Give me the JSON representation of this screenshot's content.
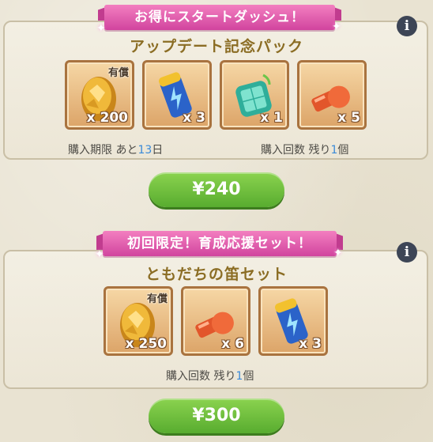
{
  "pack1": {
    "ribbon": "お得にスタートダッシュ！",
    "title": "アップデート記念パック",
    "items": [
      {
        "icon": "gem-icon",
        "qty": "x 200",
        "badge": "有償"
      },
      {
        "icon": "battery-icon",
        "qty": "x 3"
      },
      {
        "icon": "radar-device-icon",
        "qty": "x 1"
      },
      {
        "icon": "whistle-icon",
        "qty": "x 5"
      }
    ],
    "deadline_prefix": "購入期限 あと",
    "deadline_num": "13",
    "deadline_suffix": "日",
    "remaining_prefix": "購入回数 残り",
    "remaining_num": "1",
    "remaining_suffix": "個",
    "price": "¥240"
  },
  "pack2": {
    "ribbon": "初回限定！育成応援セット！",
    "title": "ともだちの笛セット",
    "items": [
      {
        "icon": "gem-icon",
        "qty": "x 250",
        "badge": "有償"
      },
      {
        "icon": "whistle-icon",
        "qty": "x 6"
      },
      {
        "icon": "battery-icon",
        "qty": "x 3"
      }
    ],
    "remaining_prefix": "購入回数 残り",
    "remaining_num": "1",
    "remaining_suffix": "個",
    "price": "¥300"
  },
  "colors": {
    "ribbon": "#d1449e",
    "price_button": "#58ac2f",
    "title_gold": "#8b6d24",
    "count_blue": "#3a8ad8"
  }
}
